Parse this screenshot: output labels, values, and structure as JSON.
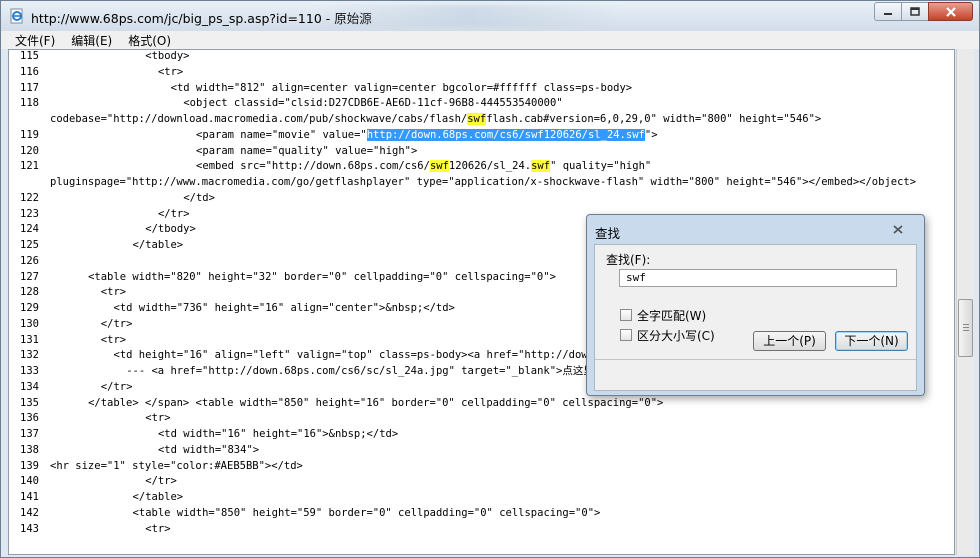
{
  "window": {
    "title": "http://www.68ps.com/jc/big_ps_sp.asp?id=110 - 原始源"
  },
  "menu": [
    "文件(F)",
    "编辑(E)",
    "格式(O)"
  ],
  "lines": [
    {
      "n": "115",
      "indent": 15,
      "segs": [
        {
          "t": "<tbody>"
        }
      ]
    },
    {
      "n": "116",
      "indent": 17,
      "segs": [
        {
          "t": "<tr>"
        }
      ]
    },
    {
      "n": "117",
      "indent": 19,
      "segs": [
        {
          "t": "<td width=\"812\" align=center valign=center bgcolor=#ffffff class=ps-body>"
        }
      ]
    },
    {
      "n": "118",
      "indent": 21,
      "segs": [
        {
          "t": "<object classid=\"clsid:D27CDB6E-AE6D-11cf-96B8-444553540000\""
        }
      ]
    },
    {
      "n": "",
      "indent": 0,
      "segs": [
        {
          "t": "codebase=\"http://download.macromedia.com/pub/shockwave/cabs/flash/"
        },
        {
          "t": "swf",
          "h": "hl"
        },
        {
          "t": "flash.cab#version=6,0,29,0\" width=\"800\" height=\"546\">"
        }
      ]
    },
    {
      "n": "119",
      "indent": 23,
      "segs": [
        {
          "t": "<param name=\"movie\" value=\""
        },
        {
          "t": "http://down.68ps.com/cs6/swf120626/sl_24.swf",
          "h": "sel"
        },
        {
          "t": "\">"
        }
      ]
    },
    {
      "n": "120",
      "indent": 23,
      "segs": [
        {
          "t": "<param name=\"quality\" value=\"high\">"
        }
      ]
    },
    {
      "n": "121",
      "indent": 23,
      "segs": [
        {
          "t": "<embed src=\"http://down.68ps.com/cs6/"
        },
        {
          "t": "swf",
          "h": "hl"
        },
        {
          "t": "120626/sl_24."
        },
        {
          "t": "swf",
          "h": "hl"
        },
        {
          "t": "\" quality=\"high\""
        }
      ]
    },
    {
      "n": "",
      "indent": 0,
      "segs": [
        {
          "t": "pluginspage=\"http://www.macromedia.com/go/getflashplayer\" type=\"application/x-shockwave-flash\" width=\"800\" height=\"546\"></embed></object>"
        }
      ]
    },
    {
      "n": "122",
      "indent": 21,
      "segs": [
        {
          "t": "</td>"
        }
      ]
    },
    {
      "n": "123",
      "indent": 17,
      "segs": [
        {
          "t": "</tr>"
        }
      ]
    },
    {
      "n": "124",
      "indent": 15,
      "segs": [
        {
          "t": "</tbody>"
        }
      ]
    },
    {
      "n": "125",
      "indent": 13,
      "segs": [
        {
          "t": "</table>"
        }
      ]
    },
    {
      "n": "126",
      "indent": 0,
      "segs": [
        {
          "t": ""
        }
      ]
    },
    {
      "n": "127",
      "indent": 6,
      "segs": [
        {
          "t": "<table width=\"820\" height=\"32\" border=\"0\" cellpadding=\"0\" cellspacing=\"0\">"
        }
      ]
    },
    {
      "n": "128",
      "indent": 8,
      "segs": [
        {
          "t": "<tr>"
        }
      ]
    },
    {
      "n": "129",
      "indent": 10,
      "segs": [
        {
          "t": "<td width=\"736\" height=\"16\" align=\"center\">&nbsp;</td>"
        }
      ]
    },
    {
      "n": "130",
      "indent": 8,
      "segs": [
        {
          "t": "</tr>"
        }
      ]
    },
    {
      "n": "131",
      "indent": 8,
      "segs": [
        {
          "t": "<tr>"
        }
      ]
    },
    {
      "n": "132",
      "indent": 10,
      "segs": [
        {
          "t": "<td height=\"16\" align=\"left\" valign=\"top\" class=ps-body><a href=\"http://down.68ps"
        }
      ]
    },
    {
      "n": "133",
      "indent": 12,
      "segs": [
        {
          "t": "--- <a href=\"http://down.68ps.com/cs6/sc/sl_24a.jpg\" target=\"_blank\">点这里查看"
        }
      ]
    },
    {
      "n": "134",
      "indent": 8,
      "segs": [
        {
          "t": "</tr>"
        }
      ]
    },
    {
      "n": "135",
      "indent": 6,
      "segs": [
        {
          "t": "</table> </span> <table width=\"850\" height=\"16\" border=\"0\" cellpadding=\"0\" cellspacing=\"0\">"
        }
      ]
    },
    {
      "n": "136",
      "indent": 15,
      "segs": [
        {
          "t": "<tr>"
        }
      ]
    },
    {
      "n": "137",
      "indent": 17,
      "segs": [
        {
          "t": "<td width=\"16\" height=\"16\">&nbsp;</td>"
        }
      ]
    },
    {
      "n": "138",
      "indent": 17,
      "segs": [
        {
          "t": "<td width=\"834\">"
        }
      ]
    },
    {
      "n": "139",
      "indent": 0,
      "segs": [
        {
          "t": "<hr size=\"1\" style=\"color:#AEB5BB\"></td>"
        }
      ]
    },
    {
      "n": "140",
      "indent": 15,
      "segs": [
        {
          "t": "</tr>"
        }
      ]
    },
    {
      "n": "141",
      "indent": 13,
      "segs": [
        {
          "t": "</table>"
        }
      ]
    },
    {
      "n": "142",
      "indent": 13,
      "segs": [
        {
          "t": "<table width=\"850\" height=\"59\" border=\"0\" cellpadding=\"0\" cellspacing=\"0\">"
        }
      ]
    },
    {
      "n": "143",
      "indent": 15,
      "segs": [
        {
          "t": "<tr>"
        }
      ]
    }
  ],
  "find_dialog": {
    "title": "查找",
    "label": "查找(F):",
    "value": "swf",
    "whole_word": "全字匹配(W)",
    "match_case": "区分大小写(C)",
    "prev_button": "上一个(P)",
    "next_button": "下一个(N)"
  },
  "colors": {
    "highlight": "#ffff33",
    "selection": "#3399ff",
    "close_button": "#c7402a"
  }
}
